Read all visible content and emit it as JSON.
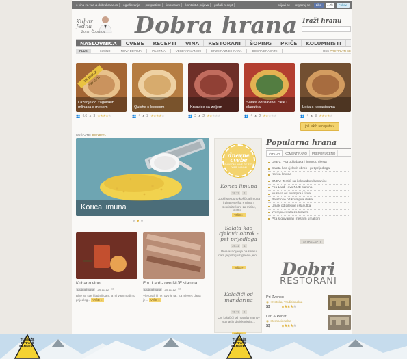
{
  "topbar": {
    "links": [
      "o vinu za vas & dobrahrana.rs",
      "oglašavanje",
      "pretplati se",
      "impresum",
      "kontakt & prijava",
      "pošalji recept"
    ],
    "prijava": "prijavi se",
    "registracija": "registruj se",
    "fb_like": "Like",
    "fb_count": "4.7k",
    "follow": "Follow"
  },
  "header": {
    "kuhar_line1": "Kuhar",
    "kuhar_line2": "Jedna",
    "chef_name": "Zoran Čobanov",
    "logo": "Dobra hrana",
    "search_label": "Traži hranu"
  },
  "nav": {
    "items": [
      "NASLOVNICA",
      "CVEBE",
      "RECEPTI",
      "VINA",
      "RESTORANI",
      "ŠOPING",
      "PRIČE",
      "KOLUMNISTI"
    ],
    "active_index": 0
  },
  "subnav": {
    "plus": "PLUS",
    "items": [
      "KUĆNO",
      "NOVA ĐEVOJA",
      "PILETINA",
      "VEGETARIJANSKI",
      "BRZE RAZNE HRANA",
      "DOBRA BRADATE"
    ],
    "right_label": "RSS",
    "right_value": "PRETPLATI SE"
  },
  "cards": [
    {
      "caption": "Lazanje od zagorskih mlinaca s mesom",
      "rating": "4.6",
      "comments": "3",
      "stars": 4,
      "ribbon": "NAJBOLJI RECEPTI"
    },
    {
      "caption": "Quiche s lososom",
      "rating": "4",
      "comments": "3",
      "stars": 4,
      "ribbon": ""
    },
    {
      "caption": "Krvavice sa zeljem",
      "rating": "2",
      "comments": "2",
      "stars": 2,
      "ribbon": ""
    },
    {
      "caption": "Salata od slavine, cikle i slanutka",
      "rating": "4",
      "comments": "2",
      "stars": 2,
      "ribbon": ""
    },
    {
      "caption": "Leća s kobasicama",
      "rating": "4",
      "comments": "3",
      "stars": 4,
      "ribbon": ""
    }
  ],
  "more_recipes": "još lakih recepata »",
  "section_label": "KUĆAJTE:",
  "section_label_value": "BONBIVA",
  "slider": {
    "caption": "Korica limuna",
    "dots": 3,
    "active_dot": 1
  },
  "articles": [
    {
      "title": "Kuhano vino",
      "tag": "Dobra hrana",
      "date": "26.11.12",
      "excerpt": "Blite se sve hladniji dani, a mi vam nudimo prijedlog...",
      "more": "VIŠE »"
    },
    {
      "title": "Fou Lard - ovo NIJE slanina",
      "tag": "Dobra hrana",
      "date": "25.11.12",
      "excerpt": "Vjerovali ili ne, ovo je tal. Za mjesec dana je...",
      "more": "VIŠE »"
    }
  ],
  "mid": {
    "badge_title": "dnevne cvebe",
    "badge_sub": "SVAKI DAN NOVE IDEJE ZA DOBRU HRANU",
    "items": [
      {
        "title": "Korica limuna",
        "date": "26.11",
        "count": "1",
        "excerpt": "Dobili ste puno koščica limuna i pitate se šta s njima? Iskoristite koru za mirise, slatke...",
        "more": "VIŠE »"
      },
      {
        "title": "Salata kao cjelovit obrok - pet prijedloga",
        "date": "26.11",
        "count": "1",
        "excerpt": "Prva asocijacija na salatu nam je prilog uz glavno jelo...",
        "more": "VIŠE »"
      },
      {
        "title": "Kolačići od mandarina",
        "date": "25.11",
        "count": "1",
        "excerpt": "Ovi kolačići od mandarina nov su način da iskoristite...",
        "more": "VIŠE »"
      }
    ]
  },
  "popular": {
    "title": "Popularna hrana",
    "tabs": [
      "ČITANO",
      "KOMENTIRANO",
      "PREPORUČENO"
    ],
    "active_tab": 0,
    "items": [
      "DNEV: Pita od jabuka i limunog tijesta",
      "Salata kao cjelovit obrok - pet prijedloga",
      "Korica limuna",
      "DNEV: Testići sa čokoladom bananice",
      "Fou Lard - ovo NIJE slanina",
      "Musaka od krumpira i tikve",
      "Palačinke od krumpira i luka",
      "Umak od piletine i slanutka",
      "Krumpir-salata sa lunkom",
      "Pita s gljivama i mesnim umakom"
    ],
    "archive": "SVI RECEPTI"
  },
  "dobri": {
    "title": "Dobri",
    "subtitle": "RESTORANI",
    "items": [
      {
        "name": "Pri Zvoncu",
        "location": "Hrvatska, Tradicionalna",
        "price": "$$",
        "stars": 4
      },
      {
        "name": "Lari & Penati",
        "location": "Internacionalna",
        "price": "$$",
        "stars": 4
      }
    ]
  },
  "ad": {
    "sign_text": "TU MOŽE BITI VAŠ BANNER..."
  },
  "colors": {
    "accent": "#e0b542",
    "nav_active": "#6b6b6b",
    "logo": "#6f6f6f"
  }
}
